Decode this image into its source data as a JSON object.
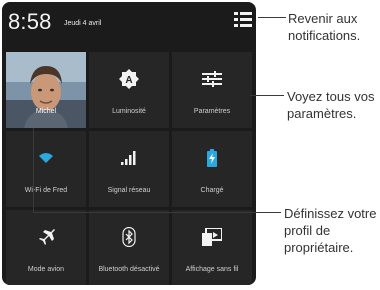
{
  "status": {
    "time": "8:58",
    "date": "Jeudi 4 avril"
  },
  "tiles": [
    {
      "label": "Michel",
      "icon": "profile-photo"
    },
    {
      "label": "Luminosité",
      "icon": "brightness-auto-icon"
    },
    {
      "label": "Paramètres",
      "icon": "settings-sliders-icon"
    },
    {
      "label": "Wi-Fi de Fred",
      "icon": "wifi-icon"
    },
    {
      "label": "Signal réseau",
      "icon": "signal-icon"
    },
    {
      "label": "Chargé",
      "icon": "battery-charging-icon"
    },
    {
      "label": "Mode avion",
      "icon": "airplane-icon"
    },
    {
      "label": "Bluetooth désactivé",
      "icon": "bluetooth-icon"
    },
    {
      "label": "Affichage sans fil",
      "icon": "cast-screen-icon"
    }
  ],
  "callouts": {
    "notifications": "Revenir aux notifications.",
    "settings": "Voyez tous vos paramètres.",
    "profile": "Définissez votre profil de propriétaire."
  },
  "colors": {
    "accent": "#2aa8e0",
    "background": "#1b1b1b",
    "tile": "#262626"
  }
}
